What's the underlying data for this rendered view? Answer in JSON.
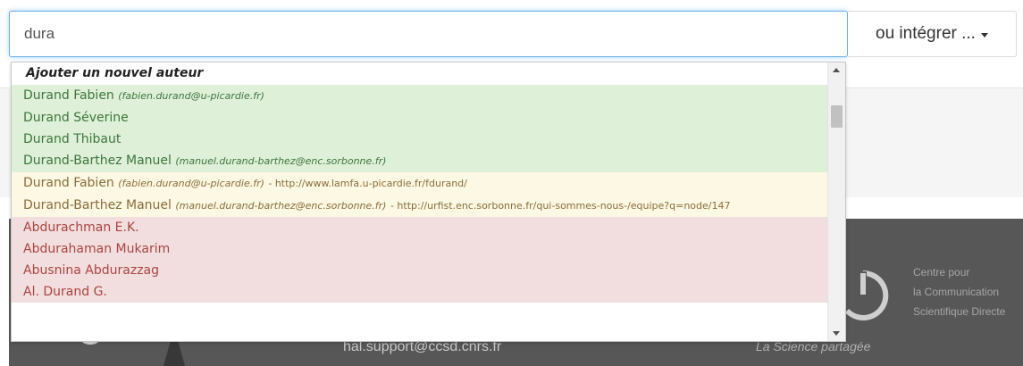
{
  "search": {
    "value": "dura"
  },
  "integrate_button": {
    "label": "ou intégrer ..."
  },
  "dropdown": {
    "header": "Ajouter un nouvel auteur",
    "green_items": [
      {
        "name": "Durand Fabien",
        "email": "(fabien.durand@u-picardie.fr)"
      },
      {
        "name": "Durand Séverine"
      },
      {
        "name": "Durand Thibaut"
      },
      {
        "name": "Durand-Barthez Manuel",
        "email": "(manuel.durand-barthez@enc.sorbonne.fr)"
      }
    ],
    "yellow_items": [
      {
        "name": "Durand Fabien",
        "email": "(fabien.durand@u-picardie.fr)",
        "url": "- http://www.lamfa.u-picardie.fr/fdurand/"
      },
      {
        "name": "Durand-Barthez Manuel",
        "email": "(manuel.durand-barthez@enc.sorbonne.fr)",
        "url": "- http://urfist.enc.sorbonne.fr/qui-sommes-nous-/equipe?q=node/147"
      }
    ],
    "red_items": [
      {
        "name": "Abdurachman E.K."
      },
      {
        "name": "Abdurahaman Mukarim"
      },
      {
        "name": "Abusnina Abdurazzag"
      },
      {
        "name": "Al. Durand G."
      }
    ]
  },
  "footer": {
    "email": "hal.support@ccsd.cnrs.fr",
    "tagline": "La Science partagée",
    "ccsd_lines": [
      "Centre pour",
      "la Communication",
      "Scientifique Directe"
    ]
  },
  "colors": {
    "green_bg": "#dff0d8",
    "yellow_bg": "#fcf8e3",
    "red_bg": "#f2dede",
    "footer_bg": "#575757"
  }
}
